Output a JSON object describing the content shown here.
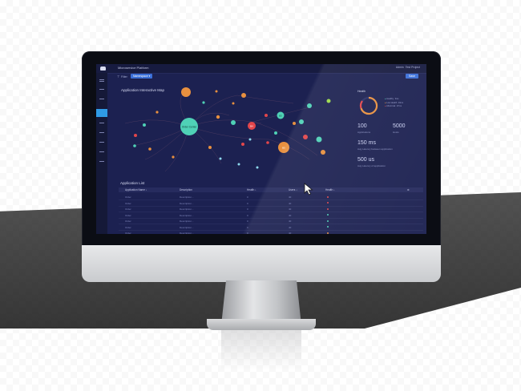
{
  "app": {
    "title": "Microservice Platform",
    "user": "Admin",
    "project": "Test Project"
  },
  "toolbar": {
    "filter_label": "Filter",
    "filter_chip": "Namespace ▾",
    "action_label": "Save"
  },
  "map": {
    "title": "Application Interactive Map",
    "central_node": "Order Center",
    "node_a": "B4",
    "node_b": "B3",
    "node_c": "B5",
    "colors": [
      "#e8903f",
      "#4fd1b6",
      "#e2464b",
      "#9ad94a",
      "#8ed9ee"
    ]
  },
  "stats": {
    "panel_title": "Health",
    "donut_legend": [
      "Healthy",
      "Low Health",
      "Abnormal"
    ],
    "donut_counts": [
      "3ms",
      "10ms",
      "17ms"
    ],
    "applications_value": "100",
    "applications_label": "Applications",
    "hosts_value": "5000",
    "hosts_label": "Hosts",
    "latency_value": "150 ms",
    "latency_label": "Avg Latency between application",
    "latency2_value": "500 us",
    "latency2_label": "Avg Latency of application"
  },
  "table": {
    "title": "Application List",
    "headers": [
      "Application Name ↓",
      "Description",
      "Health ↓",
      "Users ↓",
      "Health ↓"
    ],
    "rows": [
      {
        "name": "Order",
        "desc": "Description...",
        "health": "0",
        "users": "40",
        "color": "#e2464b"
      },
      {
        "name": "Order",
        "desc": "Description...",
        "health": "0",
        "users": "40",
        "color": "#e2464b"
      },
      {
        "name": "Order",
        "desc": "Description...",
        "health": "0",
        "users": "40",
        "color": "#e2464b"
      },
      {
        "name": "Order",
        "desc": "Description...",
        "health": "0",
        "users": "40",
        "color": "#4fd1b6"
      },
      {
        "name": "Order",
        "desc": "Description...",
        "health": "0",
        "users": "40",
        "color": "#4fd1b6"
      },
      {
        "name": "Order",
        "desc": "Description...",
        "health": "0",
        "users": "40",
        "color": "#4fd1b6"
      },
      {
        "name": "Order",
        "desc": "Description...",
        "health": "0",
        "users": "40",
        "color": "#e8903f"
      }
    ]
  }
}
